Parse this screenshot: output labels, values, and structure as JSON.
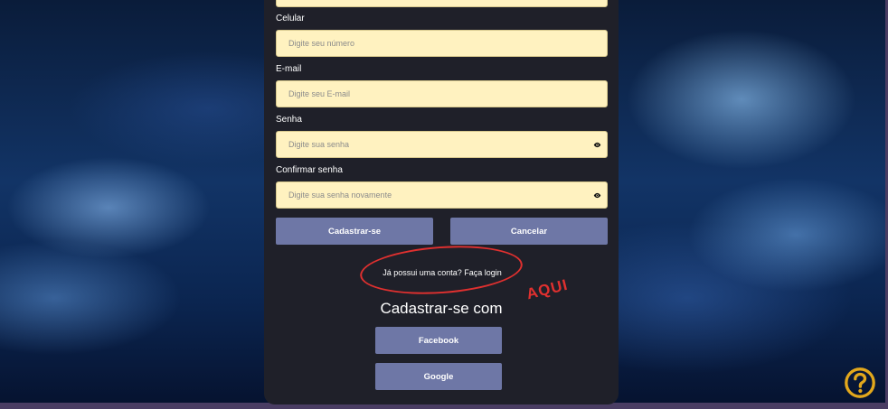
{
  "form": {
    "fields": [
      {
        "label": "Celular",
        "placeholder": "Digite seu número",
        "has_toggle": false
      },
      {
        "label": "E-mail",
        "placeholder": "Digite seu E-mail",
        "has_toggle": false
      },
      {
        "label": "Senha",
        "placeholder": "Digite sua senha",
        "has_toggle": true,
        "toggle_icon": "eye-icon"
      },
      {
        "label": "Confirmar senha",
        "placeholder": "Digite sua senha novamente",
        "has_toggle": true,
        "toggle_icon": "eye-icon"
      }
    ],
    "submit_label": "Cadastrar-se",
    "cancel_label": "Cancelar",
    "login_prompt": "Já possui uma conta? Faça login"
  },
  "annotation": {
    "text": "AQUI",
    "color": "#e0302f"
  },
  "social": {
    "heading": "Cadastrar-se com",
    "facebook_label": "Facebook",
    "google_label": "Google"
  },
  "help": {
    "icon": "question-circle-icon",
    "color": "#e3a81c"
  },
  "colors": {
    "panel": "#1f2029",
    "input_bg": "#fff2c0",
    "button": "#6e77a6"
  }
}
